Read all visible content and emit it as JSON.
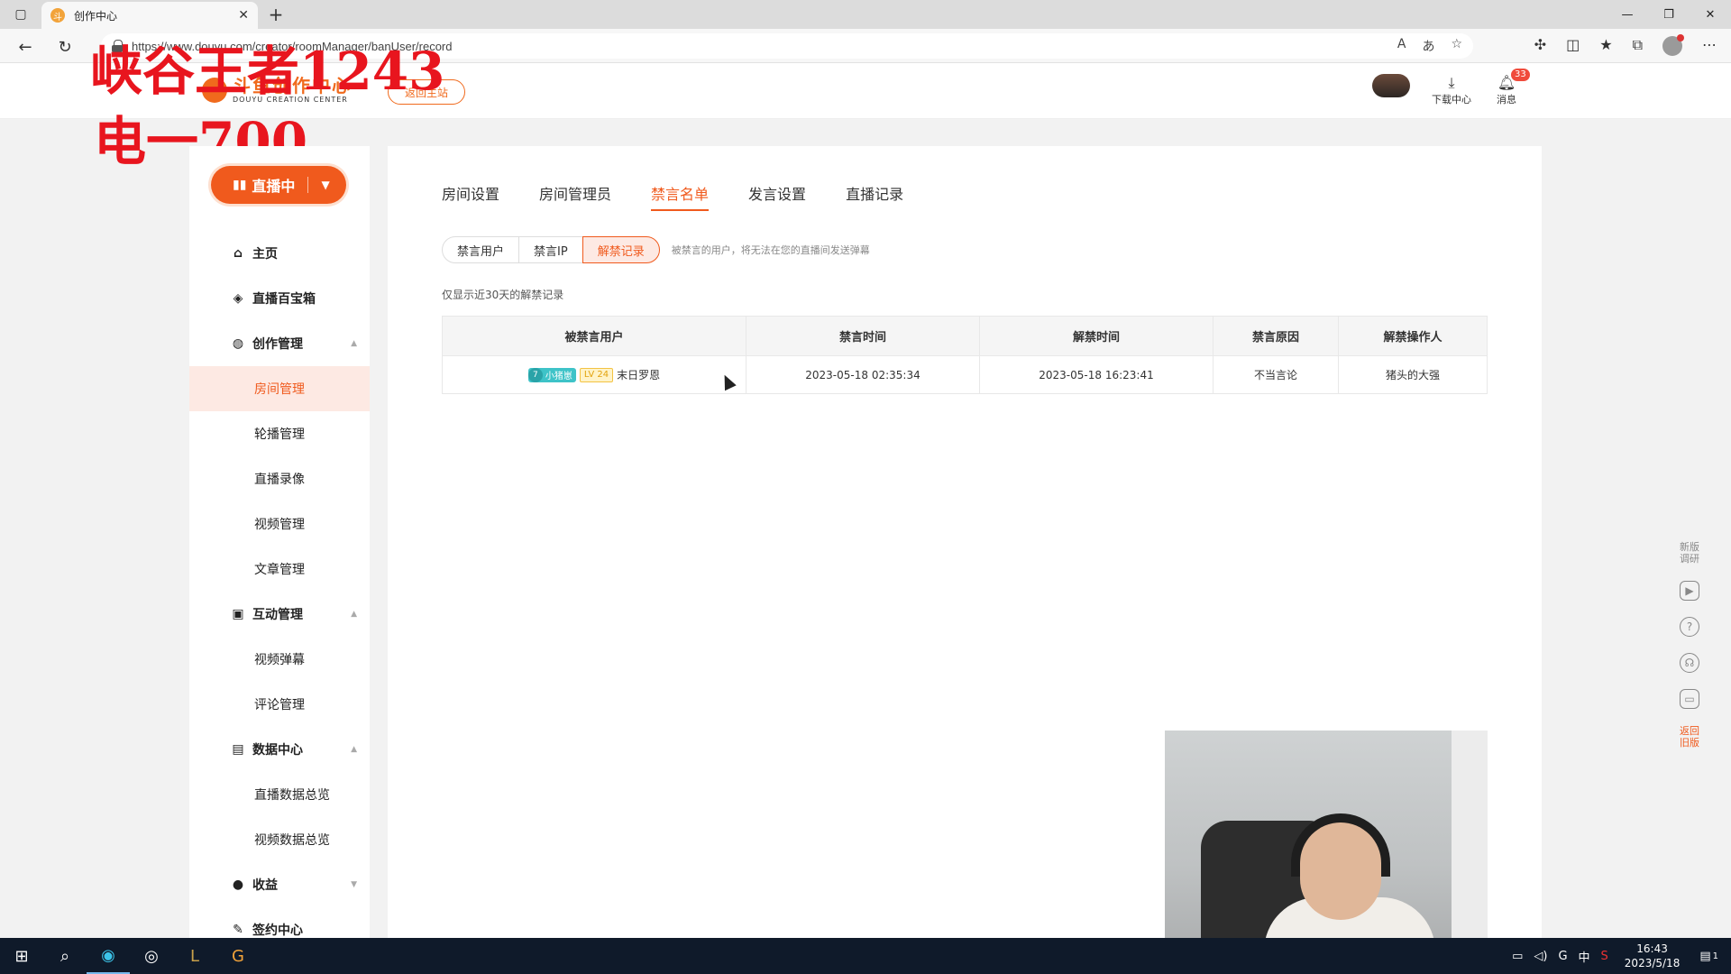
{
  "browser": {
    "tab_title": "创作中心",
    "url": "https://www.douyu.com/creator/roomManager/banUser/record"
  },
  "overlay": {
    "line1": "峡谷王者1243",
    "line2": "电一700"
  },
  "header": {
    "logo_text": "斗鱼创作中心",
    "logo_sub": "DOUYU CREATION CENTER",
    "back_home": "返回主站",
    "download_center": "下载中心",
    "messages": "消息",
    "message_badge": "33"
  },
  "sidebar": {
    "live_button": "直播中",
    "items": [
      {
        "label": "主页",
        "kind": "group",
        "icon": "home-icon",
        "glyph": "⌂"
      },
      {
        "label": "直播百宝箱",
        "kind": "group",
        "icon": "cube-icon",
        "glyph": "◈"
      },
      {
        "label": "创作管理",
        "kind": "group",
        "icon": "bulb-icon",
        "glyph": "◍",
        "arrow": "▲"
      },
      {
        "label": "房间管理",
        "kind": "sub",
        "active": true
      },
      {
        "label": "轮播管理",
        "kind": "sub"
      },
      {
        "label": "直播录像",
        "kind": "sub"
      },
      {
        "label": "视频管理",
        "kind": "sub"
      },
      {
        "label": "文章管理",
        "kind": "sub"
      },
      {
        "label": "互动管理",
        "kind": "group",
        "icon": "chat-icon",
        "glyph": "▣",
        "arrow": "▲"
      },
      {
        "label": "视频弹幕",
        "kind": "sub"
      },
      {
        "label": "评论管理",
        "kind": "sub"
      },
      {
        "label": "数据中心",
        "kind": "group",
        "icon": "chart-icon",
        "glyph": "▤",
        "arrow": "▲"
      },
      {
        "label": "直播数据总览",
        "kind": "sub"
      },
      {
        "label": "视频数据总览",
        "kind": "sub"
      },
      {
        "label": "收益",
        "kind": "group",
        "icon": "coin-icon",
        "glyph": "●",
        "arrow": "▼"
      },
      {
        "label": "签约中心",
        "kind": "group",
        "icon": "pen-icon",
        "glyph": "✎"
      }
    ]
  },
  "main": {
    "tabs": [
      "房间设置",
      "房间管理员",
      "禁言名单",
      "发言设置",
      "直播记录"
    ],
    "active_tab": 2,
    "segments": [
      "禁言用户",
      "禁言IP",
      "解禁记录"
    ],
    "active_segment": 2,
    "segment_hint": "被禁言的用户，将无法在您的直播间发送弹幕",
    "record_note": "仅显示近30天的解禁记录",
    "table": {
      "headers": [
        "被禁言用户",
        "禁言时间",
        "解禁时间",
        "禁言原因",
        "解禁操作人"
      ],
      "rows": [
        {
          "fan_level": "7",
          "fan_name": "小猪崽",
          "user_level": "LV 24",
          "user": "末日罗恩",
          "ban_time": "2023-05-18 02:35:34",
          "unban_time": "2023-05-18 16:23:41",
          "reason": "不当言论",
          "operator": "猪头的大强"
        }
      ]
    }
  },
  "float_tools": {
    "survey": "新版调研",
    "old_version": "返回旧版"
  },
  "taskbar": {
    "time": "16:43",
    "date": "2023/5/18",
    "ime": "中",
    "notification_count": "1"
  }
}
